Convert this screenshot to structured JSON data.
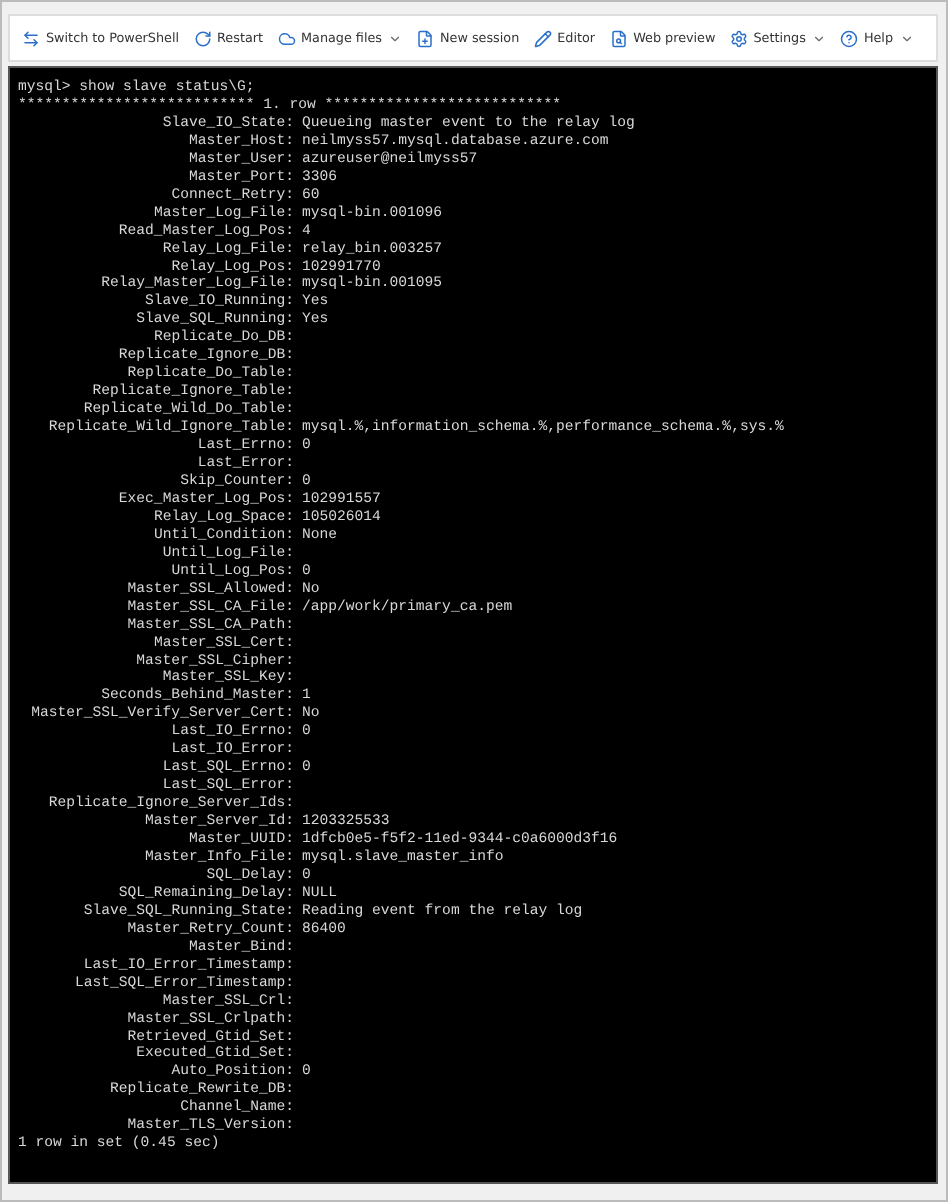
{
  "toolbar": [
    {
      "label": "Switch to PowerShell",
      "has_menu": false
    },
    {
      "label": "Restart",
      "has_menu": false
    },
    {
      "label": "Manage files",
      "has_menu": true
    },
    {
      "label": "New session",
      "has_menu": false
    },
    {
      "label": "Editor",
      "has_menu": false
    },
    {
      "label": "Web preview",
      "has_menu": false
    },
    {
      "label": "Settings",
      "has_menu": true
    },
    {
      "label": "Help",
      "has_menu": true
    }
  ],
  "terminal": {
    "command": "mysql> show slave status\\G;",
    "row_header": "*************************** 1. row ***************************",
    "fields": [
      {
        "label": "Slave_IO_State:",
        "value": "Queueing master event to the relay log"
      },
      {
        "label": "Master_Host:",
        "value": "neilmyss57.mysql.database.azure.com"
      },
      {
        "label": "Master_User:",
        "value": "azureuser@neilmyss57"
      },
      {
        "label": "Master_Port:",
        "value": "3306"
      },
      {
        "label": "Connect_Retry:",
        "value": "60"
      },
      {
        "label": "Master_Log_File:",
        "value": "mysql-bin.001096"
      },
      {
        "label": "Read_Master_Log_Pos:",
        "value": "4"
      },
      {
        "label": "Relay_Log_File:",
        "value": "relay_bin.003257"
      },
      {
        "label": "Relay_Log_Pos:",
        "value": "102991770"
      },
      {
        "label": "Relay_Master_Log_File:",
        "value": "mysql-bin.001095"
      },
      {
        "label": "Slave_IO_Running:",
        "value": "Yes"
      },
      {
        "label": "Slave_SQL_Running:",
        "value": "Yes"
      },
      {
        "label": "Replicate_Do_DB:"
      },
      {
        "label": "Replicate_Ignore_DB:"
      },
      {
        "label": "Replicate_Do_Table:"
      },
      {
        "label": "Replicate_Ignore_Table:"
      },
      {
        "label": "Replicate_Wild_Do_Table:"
      },
      {
        "label": "Replicate_Wild_Ignore_Table:",
        "value": "mysql.%,information_schema.%,performance_schema.%,sys.%"
      },
      {
        "label": "Last_Errno:",
        "value": "0"
      },
      {
        "label": "Last_Error:"
      },
      {
        "label": "Skip_Counter:",
        "value": "0"
      },
      {
        "label": "Exec_Master_Log_Pos:",
        "value": "102991557"
      },
      {
        "label": "Relay_Log_Space:",
        "value": "105026014"
      },
      {
        "label": "Until_Condition:",
        "value": "None"
      },
      {
        "label": "Until_Log_File:"
      },
      {
        "label": "Until_Log_Pos:",
        "value": "0"
      },
      {
        "label": "Master_SSL_Allowed:",
        "value": "No"
      },
      {
        "label": "Master_SSL_CA_File:",
        "value": "/app/work/primary_ca.pem"
      },
      {
        "label": "Master_SSL_CA_Path:"
      },
      {
        "label": "Master_SSL_Cert:"
      },
      {
        "label": "Master_SSL_Cipher:"
      },
      {
        "label": "Master_SSL_Key:"
      },
      {
        "label": "Seconds_Behind_Master:",
        "value": "1"
      },
      {
        "label": "Master_SSL_Verify_Server_Cert:",
        "value": "No"
      },
      {
        "label": "Last_IO_Errno:",
        "value": "0"
      },
      {
        "label": "Last_IO_Error:"
      },
      {
        "label": "Last_SQL_Errno:",
        "value": "0"
      },
      {
        "label": "Last_SQL_Error:"
      },
      {
        "label": "Replicate_Ignore_Server_Ids:"
      },
      {
        "label": "Master_Server_Id:",
        "value": "1203325533"
      },
      {
        "label": "Master_UUID:",
        "value": "1dfcb0e5-f5f2-11ed-9344-c0a6000d3f16"
      },
      {
        "label": "Master_Info_File:",
        "value": "mysql.slave_master_info"
      },
      {
        "label": "SQL_Delay:",
        "value": "0"
      },
      {
        "label": "SQL_Remaining_Delay:",
        "value": "NULL"
      },
      {
        "label": "Slave_SQL_Running_State:",
        "value": "Reading event from the relay log"
      },
      {
        "label": "Master_Retry_Count:",
        "value": "86400"
      },
      {
        "label": "Master_Bind:"
      },
      {
        "label": "Last_IO_Error_Timestamp:"
      },
      {
        "label": "Last_SQL_Error_Timestamp:"
      },
      {
        "label": "Master_SSL_Crl:"
      },
      {
        "label": "Master_SSL_Crlpath:"
      },
      {
        "label": "Retrieved_Gtid_Set:"
      },
      {
        "label": "Executed_Gtid_Set:"
      },
      {
        "label": "Auto_Position:",
        "value": "0"
      },
      {
        "label": "Replicate_Rewrite_DB:"
      },
      {
        "label": "Channel_Name:"
      },
      {
        "label": "Master_TLS_Version:"
      }
    ],
    "result": "1 row in set (0.45 sec)"
  }
}
